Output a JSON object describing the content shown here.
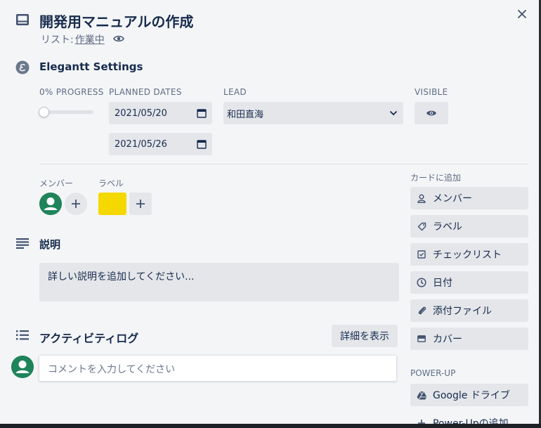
{
  "card": {
    "title": "開発用マニュアルの作成",
    "list_prefix": "リスト:",
    "list_name": "作業中"
  },
  "elegantt": {
    "title": "Elegantt Settings",
    "progress_label": "0% PROGRESS",
    "progress_value": 0,
    "planned_dates_label": "PLANNED DATES",
    "start_date": "2021/05/20",
    "end_date": "2021/05/26",
    "lead_label": "LEAD",
    "lead_value": "和田直海",
    "visible_label": "VISIBLE"
  },
  "members": {
    "label": "メンバー"
  },
  "labels": {
    "label": "ラベル",
    "chip_color": "#f5d800"
  },
  "description": {
    "title": "説明",
    "placeholder": "詳しい説明を追加してください..."
  },
  "activity": {
    "title": "アクティビティログ",
    "show_details": "詳細を表示",
    "comment_placeholder": "コメントを入力してください"
  },
  "sidebar": {
    "add_to_card_label": "カードに追加",
    "buttons": [
      {
        "label": "メンバー",
        "icon": "person-icon"
      },
      {
        "label": "ラベル",
        "icon": "tag-icon"
      },
      {
        "label": "チェックリスト",
        "icon": "checklist-icon"
      },
      {
        "label": "日付",
        "icon": "clock-icon"
      },
      {
        "label": "添付ファイル",
        "icon": "paperclip-icon"
      },
      {
        "label": "カバー",
        "icon": "card-cover-icon"
      }
    ],
    "powerup_label": "POWER-UP",
    "powerups": [
      {
        "label": "Google ドライブ",
        "icon": "google-drive-icon"
      },
      {
        "label": "Power-Upの追加",
        "icon": "plus-icon"
      }
    ]
  },
  "colors": {
    "avatar_green": "#1f845a",
    "label_yellow": "#f5d800",
    "panel_bg": "#f4f5f7"
  }
}
